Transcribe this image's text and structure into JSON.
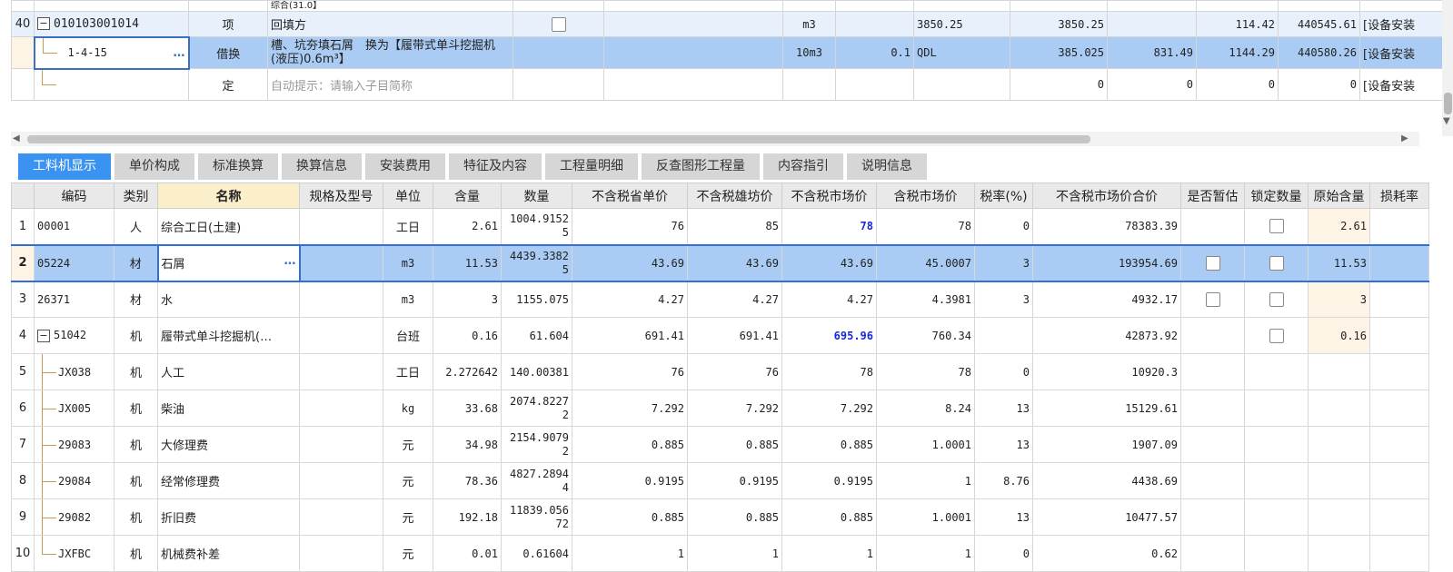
{
  "top": {
    "partial_text": "综合(31.0】",
    "rows": [
      {
        "num": "40",
        "code": "010103001014",
        "type": "项",
        "name": "回填方",
        "unit": "m3",
        "qty": "",
        "expr": "3850.25",
        "qty2": "3850.25",
        "price": "",
        "unitp": "114.42",
        "total": "440545.61",
        "prof": "[设备安装"
      },
      {
        "num": "",
        "code": "1-4-15",
        "type": "借换",
        "name": "槽、坑夯填石屑　换为【履带式单斗挖掘机(液压)0.6m³】",
        "unit": "10m3",
        "qty": "0.1",
        "expr": "QDL",
        "qty2": "385.025",
        "price": "831.49",
        "unitp": "1144.29",
        "total": "440580.26",
        "prof": "[设备安装"
      },
      {
        "num": "",
        "code": "",
        "type": "定",
        "name": "自动提示：请输入子目简称",
        "unit": "",
        "qty": "",
        "expr": "",
        "qty2": "0",
        "price": "0",
        "unitp": "0",
        "total": "0",
        "prof": "[设备安装"
      }
    ]
  },
  "tabs": [
    "工料机显示",
    "单价构成",
    "标准换算",
    "换算信息",
    "安装费用",
    "特征及内容",
    "工程量明细",
    "反查图形工程量",
    "内容指引",
    "说明信息"
  ],
  "headers": [
    "编码",
    "类别",
    "名称",
    "规格及型号",
    "单位",
    "含量",
    "数量",
    "不含税省单价",
    "不含税雄坊价",
    "不含税市场价",
    "含税市场价",
    "税率(%)",
    "不含税市场价合价",
    "是否暂估",
    "锁定数量",
    "原始含量",
    "损耗率"
  ],
  "rows": [
    {
      "n": "1",
      "code": "00001",
      "cat": "人",
      "name": "综合工日(土建)",
      "unit": "工日",
      "content": "2.61",
      "qty": "1004.91525",
      "p1": "76",
      "p2": "85",
      "p3": "78",
      "p4": "78",
      "tax": "0",
      "total": "78383.39",
      "orig": "2.61"
    },
    {
      "n": "2",
      "code": "05224",
      "cat": "材",
      "name": "石屑",
      "unit": "m3",
      "content": "11.53",
      "qty": "4439.33825",
      "p1": "43.69",
      "p2": "43.69",
      "p3": "43.69",
      "p4": "45.0007",
      "tax": "3",
      "total": "193954.69",
      "orig": "11.53"
    },
    {
      "n": "3",
      "code": "26371",
      "cat": "材",
      "name": "水",
      "unit": "m3",
      "content": "3",
      "qty": "1155.075",
      "p1": "4.27",
      "p2": "4.27",
      "p3": "4.27",
      "p4": "4.3981",
      "tax": "3",
      "total": "4932.17",
      "orig": "3"
    },
    {
      "n": "4",
      "code": "51042",
      "cat": "机",
      "name": "履带式单斗挖掘机(…",
      "unit": "台班",
      "content": "0.16",
      "qty": "61.604",
      "p1": "691.41",
      "p2": "691.41",
      "p3": "695.96",
      "p4": "760.34",
      "tax": "",
      "total": "42873.92",
      "orig": "0.16"
    },
    {
      "n": "5",
      "code": "JX038",
      "cat": "机",
      "name": "人工",
      "unit": "工日",
      "content": "2.272642",
      "qty": "140.00381",
      "p1": "76",
      "p2": "76",
      "p3": "78",
      "p4": "78",
      "tax": "0",
      "total": "10920.3",
      "orig": ""
    },
    {
      "n": "6",
      "code": "JX005",
      "cat": "机",
      "name": "柴油",
      "unit": "kg",
      "content": "33.68",
      "qty": "2074.82272",
      "p1": "7.292",
      "p2": "7.292",
      "p3": "7.292",
      "p4": "8.24",
      "tax": "13",
      "total": "15129.61",
      "orig": ""
    },
    {
      "n": "7",
      "code": "29083",
      "cat": "机",
      "name": "大修理费",
      "unit": "元",
      "content": "34.98",
      "qty": "2154.90792",
      "p1": "0.885",
      "p2": "0.885",
      "p3": "0.885",
      "p4": "1.0001",
      "tax": "13",
      "total": "1907.09",
      "orig": ""
    },
    {
      "n": "8",
      "code": "29084",
      "cat": "机",
      "name": "经常修理费",
      "unit": "元",
      "content": "78.36",
      "qty": "4827.28944",
      "p1": "0.9195",
      "p2": "0.9195",
      "p3": "0.9195",
      "p4": "1",
      "tax": "8.76",
      "total": "4438.69",
      "orig": ""
    },
    {
      "n": "9",
      "code": "29082",
      "cat": "机",
      "name": "折旧费",
      "unit": "元",
      "content": "192.18",
      "qty": "11839.05672",
      "p1": "0.885",
      "p2": "0.885",
      "p3": "0.885",
      "p4": "1.0001",
      "tax": "13",
      "total": "10477.57",
      "orig": ""
    },
    {
      "n": "10",
      "code": "JXFBC",
      "cat": "机",
      "name": "机械费补差",
      "unit": "元",
      "content": "0.01",
      "qty": "0.61604",
      "p1": "1",
      "p2": "1",
      "p3": "1",
      "p4": "1",
      "tax": "0",
      "total": "0.62",
      "orig": ""
    }
  ],
  "qty_lines": {
    "r1": [
      "1004.9152",
      "5"
    ],
    "r2": [
      "4439.3382",
      "5"
    ],
    "r6": [
      "2074.8227",
      "2"
    ],
    "r7": [
      "2154.9079",
      "2"
    ],
    "r8": [
      "4827.2894",
      "4"
    ],
    "r9": [
      "11839.056",
      "72"
    ]
  },
  "ellipsis": "…",
  "minus": "−",
  "colors": {
    "accent": "#3a93f0",
    "selected_row": "#aaccf4",
    "header_bg": "#e9e9e9",
    "blue_text": "#1a28d8"
  }
}
